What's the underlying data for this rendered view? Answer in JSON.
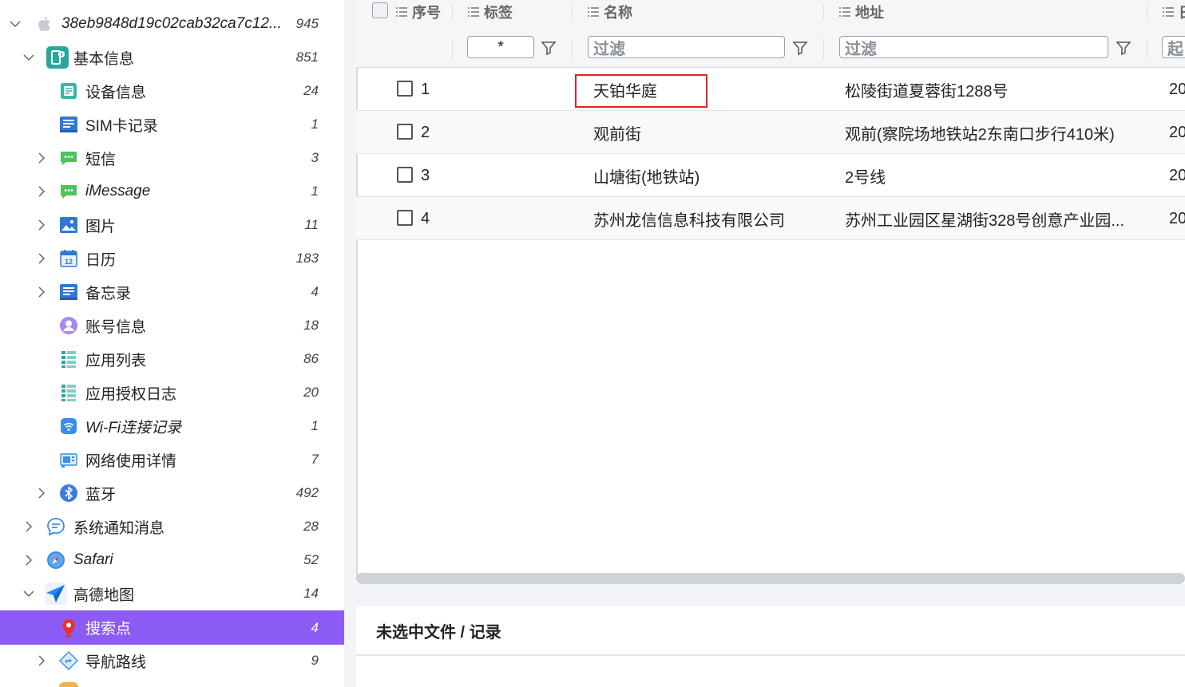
{
  "sidebar": {
    "items": [
      {
        "label": "38eb9848d19c02cab32ca7c12...",
        "count": "945",
        "icon": "apple-icon",
        "italic": true
      },
      {
        "label": "基本信息",
        "count": "851",
        "icon": "info-card-icon"
      },
      {
        "label": "设备信息",
        "count": "24",
        "icon": "device-info-icon"
      },
      {
        "label": "SIM卡记录",
        "count": "1",
        "icon": "sim-record-icon"
      },
      {
        "label": "短信",
        "count": "3",
        "icon": "sms-icon"
      },
      {
        "label": "iMessage",
        "count": "1",
        "icon": "imessage-icon",
        "italic": true
      },
      {
        "label": "图片",
        "count": "11",
        "icon": "image-icon"
      },
      {
        "label": "日历",
        "count": "183",
        "icon": "calendar-icon",
        "icon_text": "12"
      },
      {
        "label": "备忘录",
        "count": "4",
        "icon": "notes-icon"
      },
      {
        "label": "账号信息",
        "count": "18",
        "icon": "account-icon"
      },
      {
        "label": "应用列表",
        "count": "86",
        "icon": "app-list-icon"
      },
      {
        "label": "应用授权日志",
        "count": "20",
        "icon": "app-auth-log-icon"
      },
      {
        "label": "Wi-Fi连接记录",
        "count": "1",
        "icon": "wifi-icon"
      },
      {
        "label": "网络使用详情",
        "count": "7",
        "icon": "network-usage-icon"
      },
      {
        "label": "蓝牙",
        "count": "492",
        "icon": "bluetooth-icon"
      },
      {
        "label": "系统通知消息",
        "count": "28",
        "icon": "notification-icon"
      },
      {
        "label": "Safari",
        "count": "52",
        "icon": "safari-icon",
        "italic": true
      },
      {
        "label": "高德地图",
        "count": "14",
        "icon": "amap-icon"
      },
      {
        "label": "搜索点",
        "count": "4",
        "icon": "location-pin-icon"
      },
      {
        "label": "导航路线",
        "count": "9",
        "icon": "navigation-route-icon"
      }
    ],
    "selected_index": 18
  },
  "table": {
    "columns": [
      "序号",
      "标签",
      "名称",
      "地址",
      "日"
    ],
    "filters": {
      "tag": "*",
      "name_placeholder": "过滤",
      "address_placeholder": "过滤",
      "date_placeholder": "起"
    },
    "rows": [
      {
        "index": "1",
        "name": "天铂华庭",
        "address": "松陵街道夏蓉街1288号",
        "date": "20"
      },
      {
        "index": "2",
        "name": "观前街",
        "address": "观前(察院场地铁站2东南口步行410米)",
        "date": "20"
      },
      {
        "index": "3",
        "name": "山塘街(地铁站)",
        "address": "2号线",
        "date": "20"
      },
      {
        "index": "4",
        "name": "苏州龙信信息科技有限公司",
        "address": "苏州工业园区星湖街328号创意产业园...",
        "date": "20"
      }
    ]
  },
  "status": {
    "text": "未选中文件 / 记录"
  },
  "colors": {
    "selected_bg": "#8b5cf6",
    "highlight_border": "#e02424"
  }
}
